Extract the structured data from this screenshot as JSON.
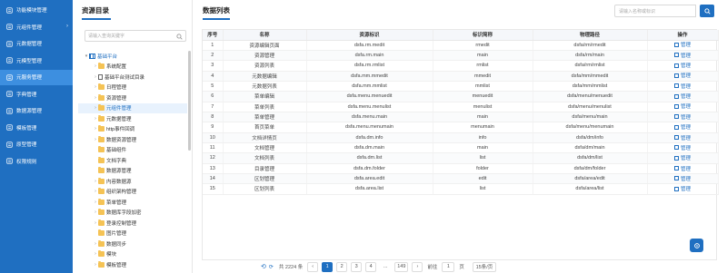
{
  "colors": {
    "primary": "#1f6fc1",
    "sidebar_active": "#3d8fe0"
  },
  "sidebar": {
    "items": [
      {
        "label": "功能模块管理",
        "icon": "grid-icon",
        "arrow": ""
      },
      {
        "label": "元组件管理",
        "icon": "component-icon",
        "arrow": "›"
      },
      {
        "label": "元数据管理",
        "icon": "database-icon",
        "arrow": ""
      },
      {
        "label": "元模型管理",
        "icon": "model-icon",
        "arrow": ""
      },
      {
        "label": "元服务管理",
        "icon": "service-icon",
        "arrow": ""
      },
      {
        "label": "字典管理",
        "icon": "dictionary-icon",
        "arrow": ""
      },
      {
        "label": "数据源管理",
        "icon": "datasource-icon",
        "arrow": ""
      },
      {
        "label": "模板管理",
        "icon": "template-icon",
        "arrow": ""
      },
      {
        "label": "原型管理",
        "icon": "prototype-icon",
        "arrow": ""
      },
      {
        "label": "权限规则",
        "icon": "permission-icon",
        "arrow": ""
      }
    ]
  },
  "tree": {
    "title": "资源目录",
    "search_placeholder": "请输入查询关键字",
    "nodes": [
      {
        "label": "基础平台",
        "level": 0,
        "caret": "▾",
        "icon": "grid"
      },
      {
        "label": "系统配置",
        "level": 1,
        "caret": "›",
        "icon": "folder"
      },
      {
        "label": "基础平台测试目录",
        "level": 1,
        "caret": "›",
        "icon": "page"
      },
      {
        "label": "日程管理",
        "level": 1,
        "caret": "›",
        "icon": "folder"
      },
      {
        "label": "资源管理",
        "level": 1,
        "caret": "›",
        "icon": "folder"
      },
      {
        "label": "元组件管理",
        "level": 1,
        "caret": "›",
        "icon": "folder"
      },
      {
        "label": "元数据管理",
        "level": 1,
        "caret": "›",
        "icon": "folder"
      },
      {
        "label": "http事件回调",
        "level": 1,
        "caret": "›",
        "icon": "folder"
      },
      {
        "label": "数据资源管理",
        "level": 1,
        "caret": "›",
        "icon": "folder"
      },
      {
        "label": "基础组件",
        "level": 1,
        "caret": "",
        "icon": "folder"
      },
      {
        "label": "文档字典",
        "level": 1,
        "caret": "",
        "icon": "folder"
      },
      {
        "label": "数据源管理",
        "level": 1,
        "caret": "",
        "icon": "folder"
      },
      {
        "label": "内容数据源",
        "level": 1,
        "caret": "›",
        "icon": "folder"
      },
      {
        "label": "组织架构管理",
        "level": 1,
        "caret": "›",
        "icon": "folder"
      },
      {
        "label": "菜单管理",
        "level": 1,
        "caret": "›",
        "icon": "folder"
      },
      {
        "label": "数据库字段加密",
        "level": 1,
        "caret": "›",
        "icon": "folder"
      },
      {
        "label": "登录控制管理",
        "level": 1,
        "caret": "›",
        "icon": "folder"
      },
      {
        "label": "图片管理",
        "level": 1,
        "caret": "",
        "icon": "folder"
      },
      {
        "label": "数据同步",
        "level": 1,
        "caret": "›",
        "icon": "folder"
      },
      {
        "label": "模块",
        "level": 1,
        "caret": "›",
        "icon": "folder"
      },
      {
        "label": "模板管理",
        "level": 1,
        "caret": "›",
        "icon": "folder"
      }
    ]
  },
  "main": {
    "title": "数据列表",
    "search_placeholder": "请输入名称或标识",
    "columns": [
      "序号",
      "名称",
      "资源标识",
      "标识简称",
      "物理路径",
      "操作"
    ],
    "action_label": "管理",
    "rows": [
      [
        "1",
        "资源编辑页面",
        "dsfa.rm.medit",
        "rmedit",
        "dsfa/rm/rmedit"
      ],
      [
        "2",
        "资源管理",
        "dsfa.rm.main",
        "main",
        "dsfa/rm/main"
      ],
      [
        "3",
        "资源列表",
        "dsfa.rm.rmlist",
        "rmlist",
        "dsfa/rm/rmlist"
      ],
      [
        "4",
        "元数据编辑",
        "dsfa.mm.mmedit",
        "mmedit",
        "dsfa/mm/mmedit"
      ],
      [
        "5",
        "元数据列表",
        "dsfa.mm.mmlist",
        "mmlist",
        "dsfa/mm/mmlist"
      ],
      [
        "6",
        "菜单编辑",
        "dsfa.menu.menuedit",
        "menuedit",
        "dsfa/menu/menuedit"
      ],
      [
        "7",
        "菜单列表",
        "dsfa.menu.menulist",
        "menulist",
        "dsfa/menu/menulist"
      ],
      [
        "8",
        "菜单管理",
        "dsfa.menu.main",
        "main",
        "dsfa/menu/main"
      ],
      [
        "9",
        "首页菜单",
        "dsfa.menu.menumain",
        "menumain",
        "dsfa/menu/menumain"
      ],
      [
        "10",
        "文档详情页",
        "dsfa.dm.info",
        "info",
        "dsfa/dm/info"
      ],
      [
        "11",
        "文档管理",
        "dsfa.dm.main",
        "main",
        "dsfa/dm/main"
      ],
      [
        "12",
        "文档列表",
        "dsfa.dm.list",
        "list",
        "dsfa/dm/list"
      ],
      [
        "13",
        "目录管理",
        "dsfa.dm.folder",
        "folder",
        "dsfa/dm/folder"
      ],
      [
        "14",
        "区划管理",
        "dsfa.area.edit",
        "edit",
        "dsfa/area/edit"
      ],
      [
        "15",
        "区划列表",
        "dsfa.area.list",
        "list",
        "dsfa/area/list"
      ]
    ]
  },
  "pager": {
    "total_text": "共 2224 条",
    "pages": [
      "1",
      "2",
      "3",
      "4",
      "...",
      "149"
    ],
    "current": "1",
    "prev": "‹",
    "next": "›",
    "goto_prefix": "前往",
    "goto_value": "1",
    "goto_suffix": "页",
    "page_size": "15条/页"
  }
}
